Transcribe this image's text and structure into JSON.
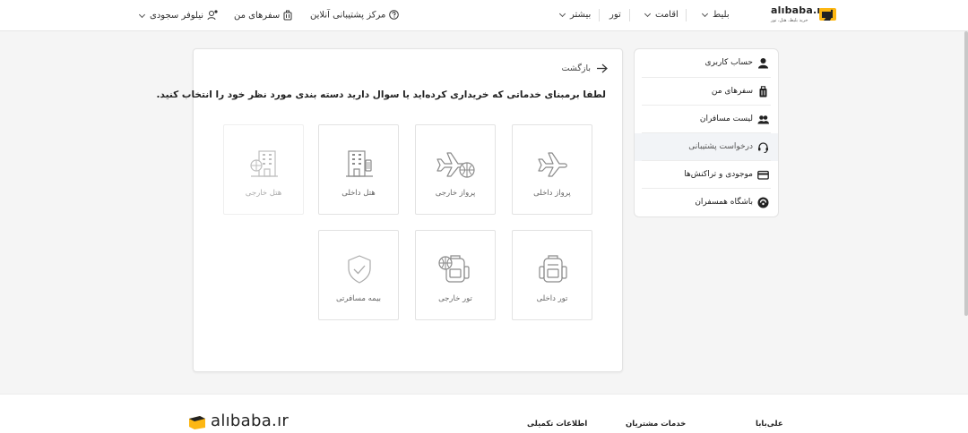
{
  "header": {
    "logo_text": "alıbaba.ır",
    "logo_tagline": "خرید بلیط، هتل، تور",
    "nav": {
      "ticket": "بلیط",
      "stay": "اقامت",
      "tour": "تور",
      "more": "بیشتر"
    },
    "support_center": "مرکز پشتیبانی آنلاین",
    "my_trips": "سفرهای من",
    "user_name": "نیلوفر سجودی"
  },
  "sidebar": {
    "items": [
      {
        "label": "حساب کاربری",
        "icon": "user-icon"
      },
      {
        "label": "سفرهای من",
        "icon": "luggage-icon"
      },
      {
        "label": "لیست مسافران",
        "icon": "users-icon"
      },
      {
        "label": "درخواست پشتیبانی",
        "icon": "headset-icon",
        "active": true
      },
      {
        "label": "موجودی و تراکنش‌ها",
        "icon": "wallet-icon"
      },
      {
        "label": "باشگاه همسفران",
        "icon": "club-icon"
      }
    ]
  },
  "main": {
    "back_label": "بازگشت",
    "prompt": "لطفا برمبنای خدماتی که خریداری کرده‌اید یا سوال دارید دسته بندی مورد نظر خود را انتخاب کنید.",
    "categories": {
      "domestic_flight": "پرواز داخلی",
      "foreign_flight": "پرواز خارجی",
      "domestic_hotel": "هتل داخلی",
      "foreign_hotel": "هتل خارجی",
      "domestic_tour": "تور داخلی",
      "foreign_tour": "تور خارجی",
      "travel_insurance": "بیمه مسافرتی"
    }
  },
  "footer": {
    "logo_text": "alıbaba.ır",
    "col_alibaba": "علی‌بابا",
    "col_customer": "خدمات مشتریان",
    "col_info": "اطلاعات تکمیلی"
  },
  "colors": {
    "brand_yellow": "#fdb713",
    "dark": "#222222",
    "icon_gray": "#8a8a8a"
  }
}
